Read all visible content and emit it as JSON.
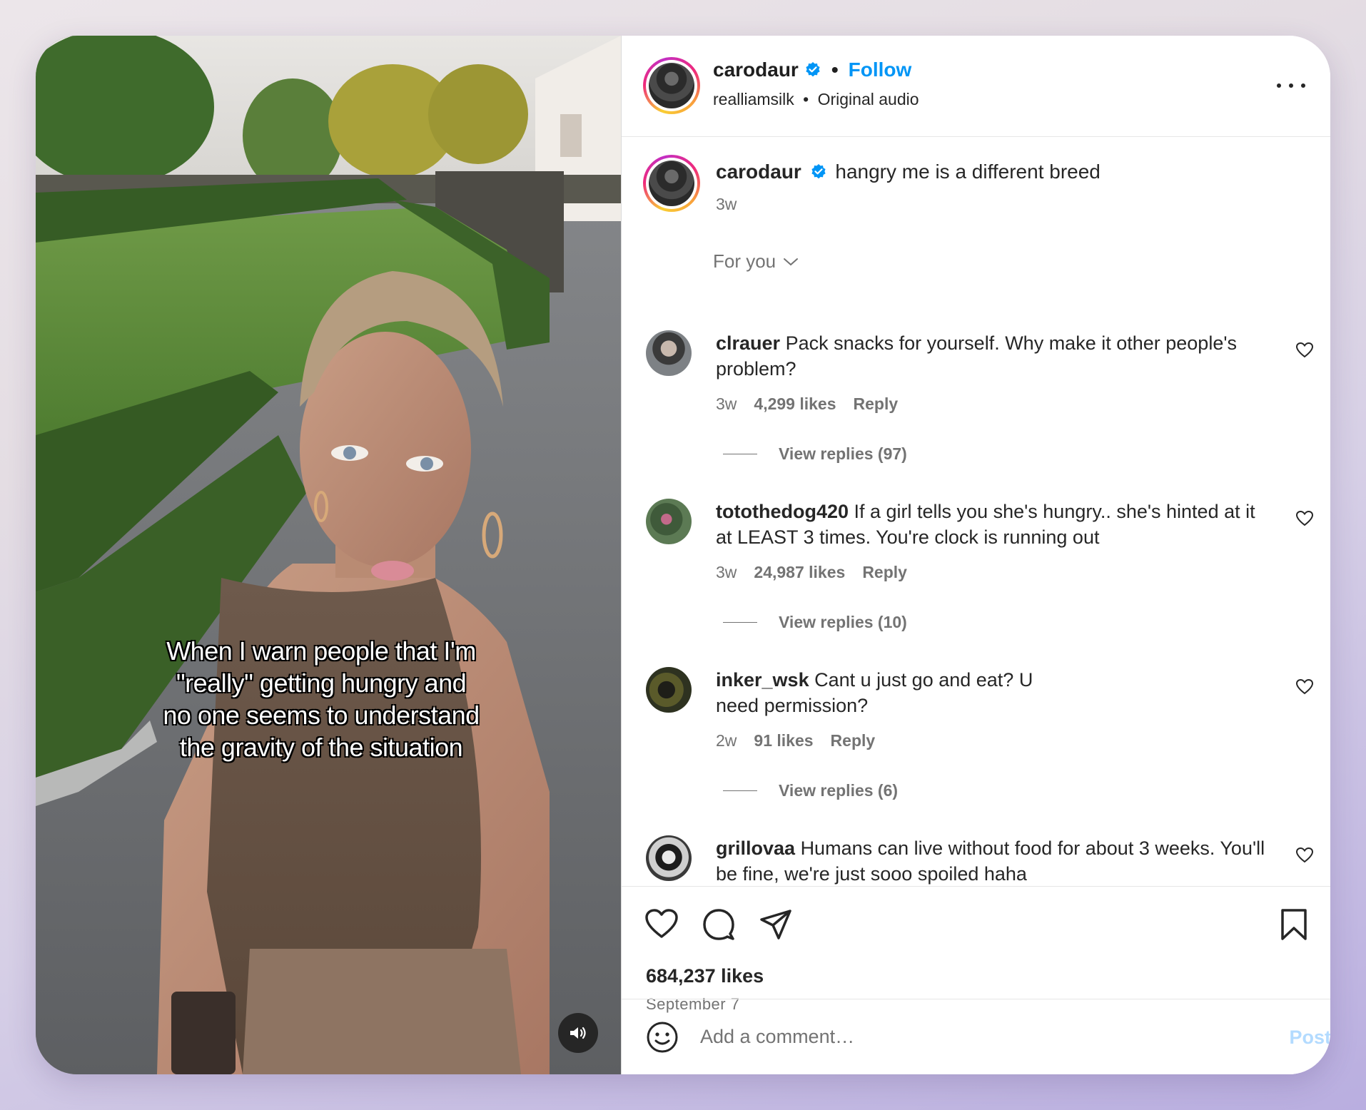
{
  "post": {
    "author": "carodaur",
    "follow_label": "Follow",
    "separator": "•",
    "audio_artist": "realliamsilk",
    "audio_sep": "•",
    "audio_name": "Original audio",
    "caption_text": "hangry me is a different breed",
    "caption_time": "3w",
    "video_caption_lines": [
      "When I warn people that I'm",
      "\"really\" getting hungry and",
      "no one seems to understand",
      "the gravity of the situation"
    ],
    "likes": "684,237 likes",
    "date": "September 7"
  },
  "filter": {
    "label": "For you"
  },
  "comments": [
    {
      "user": "clrauer",
      "text": "Pack snacks for yourself. Why make it other people's problem?",
      "time": "3w",
      "likes": "4,299 likes",
      "reply_label": "Reply",
      "view_replies": "View replies (97)"
    },
    {
      "user": "totothedog420",
      "text": "If a girl tells you she's hungry.. she's hinted at it at LEAST 3 times. You're clock is running out",
      "time": "3w",
      "likes": "24,987 likes",
      "reply_label": "Reply",
      "view_replies": "View replies (10)"
    },
    {
      "user": "inker_wsk",
      "text": "Cant u just go and eat? U need permission?",
      "time": "2w",
      "likes": "91 likes",
      "reply_label": "Reply",
      "view_replies": "View replies (6)"
    },
    {
      "user": "grillovaa",
      "text": "Humans can live without food for about 3 weeks. You'll be fine, we're just sooo spoiled haha"
    }
  ],
  "composer": {
    "placeholder": "Add a comment…",
    "post_label": "Post"
  },
  "icons": [
    "verified-badge-icon",
    "more-options-icon",
    "chevron-down-icon",
    "heart-icon",
    "comment-icon",
    "share-icon",
    "bookmark-icon",
    "emoji-icon",
    "sound-icon"
  ],
  "colors": {
    "accent": "#0095f6",
    "muted": "#737373",
    "text": "#262626",
    "post_disabled": "#b3dbff"
  }
}
